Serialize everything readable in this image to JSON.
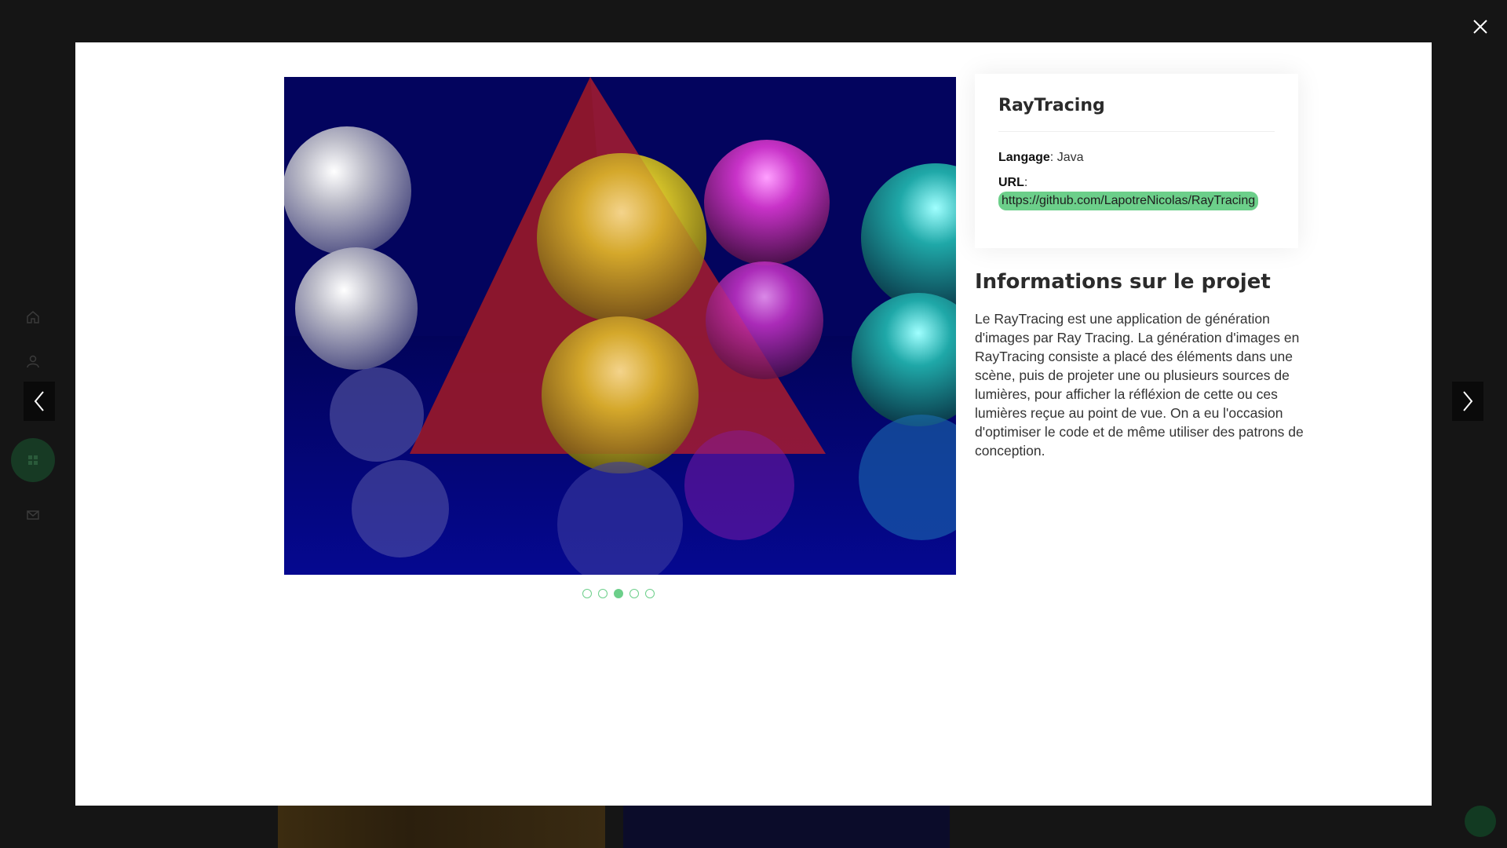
{
  "project": {
    "title": "RayTracing",
    "language_label": "Langage",
    "language_value": "Java",
    "url_label": "URL",
    "url_value": "https://github.com/LapotreNicolas/RayTracing"
  },
  "description": {
    "title": "Informations sur le projet",
    "text": "Le RayTracing est une application de génération d'images par Ray Tracing. La génération d'images en RayTracing consiste a placé des éléments dans une scène, puis de projeter une ou plusieurs sources de lumières, pour afficher la réfléxion de cette ou ces lumières reçue au point de vue. On a eu l'occasion d'optimiser le code et de même utiliser des patrons de conception."
  },
  "slider": {
    "slide_count": 5,
    "active_index": 2,
    "colors": {
      "background": "#03045e",
      "pyramid": "#b01e2a",
      "silver": "#c9c9d6",
      "gold": "#d7c12a",
      "magenta": "#c832c8",
      "cyan": "#1fa8a8"
    }
  },
  "controls": {
    "close_icon": "close-icon",
    "prev_icon": "chevron-left-icon",
    "next_icon": "chevron-right-icon"
  },
  "background_nav": [
    "home-icon",
    "user-icon",
    "briefcase-icon",
    "grid-icon",
    "mail-icon"
  ],
  "theme": {
    "accent": "#6ccf8a",
    "overlay": "#151515"
  }
}
